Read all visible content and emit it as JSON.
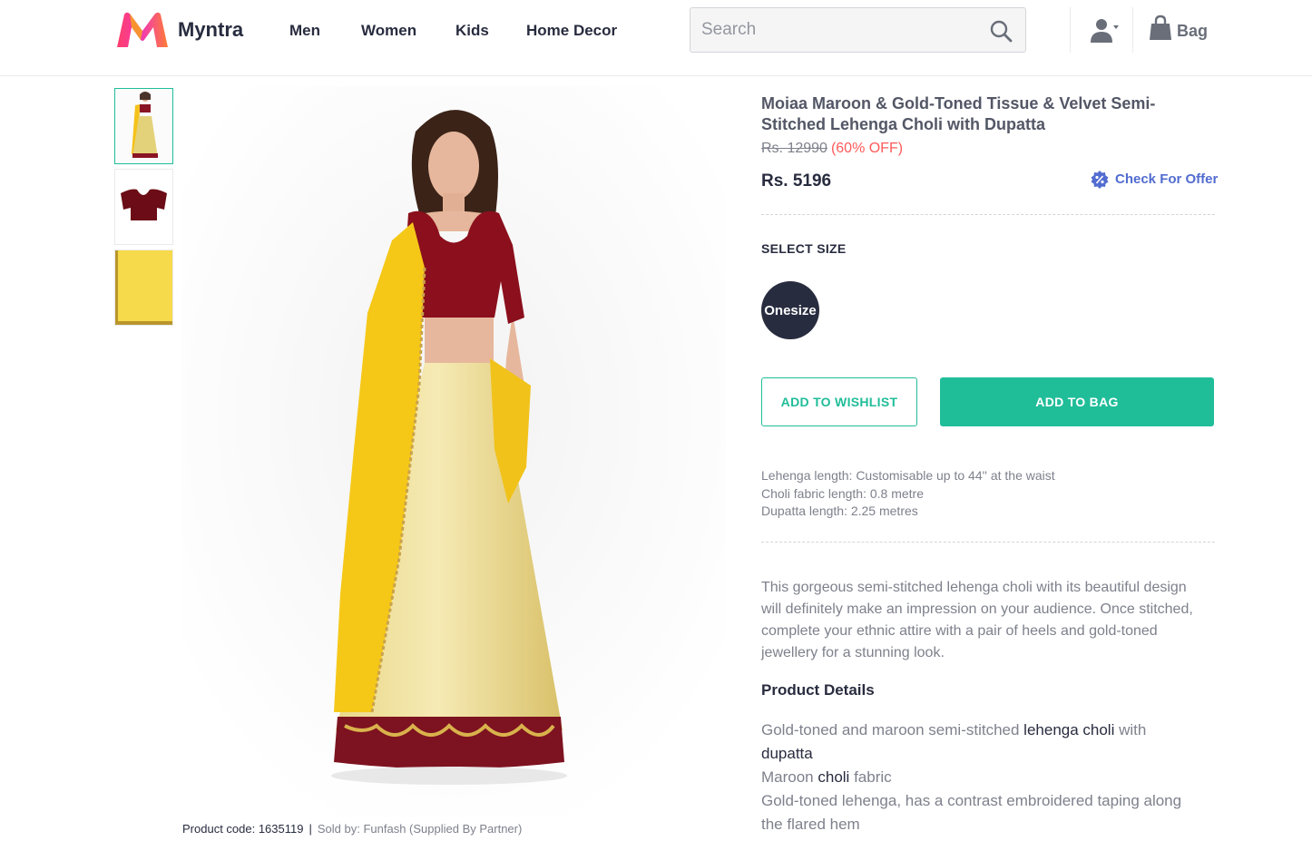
{
  "header": {
    "brand": "Myntra",
    "nav": [
      "Men",
      "Women",
      "Kids",
      "Home Decor"
    ],
    "search_placeholder": "Search",
    "bag_label": "Bag"
  },
  "product": {
    "title": "Moiaa Maroon & Gold-Toned Tissue & Velvet Semi-Stitched Lehenga Choli with Dupatta",
    "mrp": "Rs. 12990",
    "discount": "(60% OFF)",
    "price": "Rs. 5196",
    "offer_link": "Check For Offer",
    "select_size_label": "SELECT SIZE",
    "size": "Onesize",
    "wishlist_label": "ADD TO WISHLIST",
    "add_to_bag_label": "ADD TO BAG",
    "specs": [
      "Lehenga length: Customisable up to 44'' at the waist",
      "Choli fabric length: 0.8 metre",
      "Dupatta length: 2.25 metres"
    ],
    "description": "This gorgeous semi-stitched lehenga choli with its beautiful design will definitely make an impression on your audience. Once stitched, complete your ethnic attire with a pair of heels and gold-toned jewellery for a stunning look.",
    "details_title": "Product Details",
    "details": {
      "line1_a": "Gold-toned and maroon",
      "line1_b": "semi-stitched",
      "line1_c": "lehenga choli",
      "line1_d": "with",
      "line2": "dupatta",
      "line3_a": "Maroon",
      "line3_b": "choli",
      "line3_c": "fabric",
      "line4": "Gold-toned lehenga, has a contrast embroidered taping along",
      "line5_a": "the",
      "line5_b": "flared hem"
    },
    "product_code": "Product code: 1635119",
    "separator": "|",
    "sold_by": "Sold by: Funfash (Supplied By Partner)"
  },
  "colors": {
    "accent": "#20bd99",
    "discount": "#ff5a5a",
    "offer": "#526cd0",
    "dark": "#282c3f"
  },
  "icons": [
    "myntra-logo",
    "search-icon",
    "user-icon",
    "bag-icon",
    "offer-badge-icon"
  ]
}
